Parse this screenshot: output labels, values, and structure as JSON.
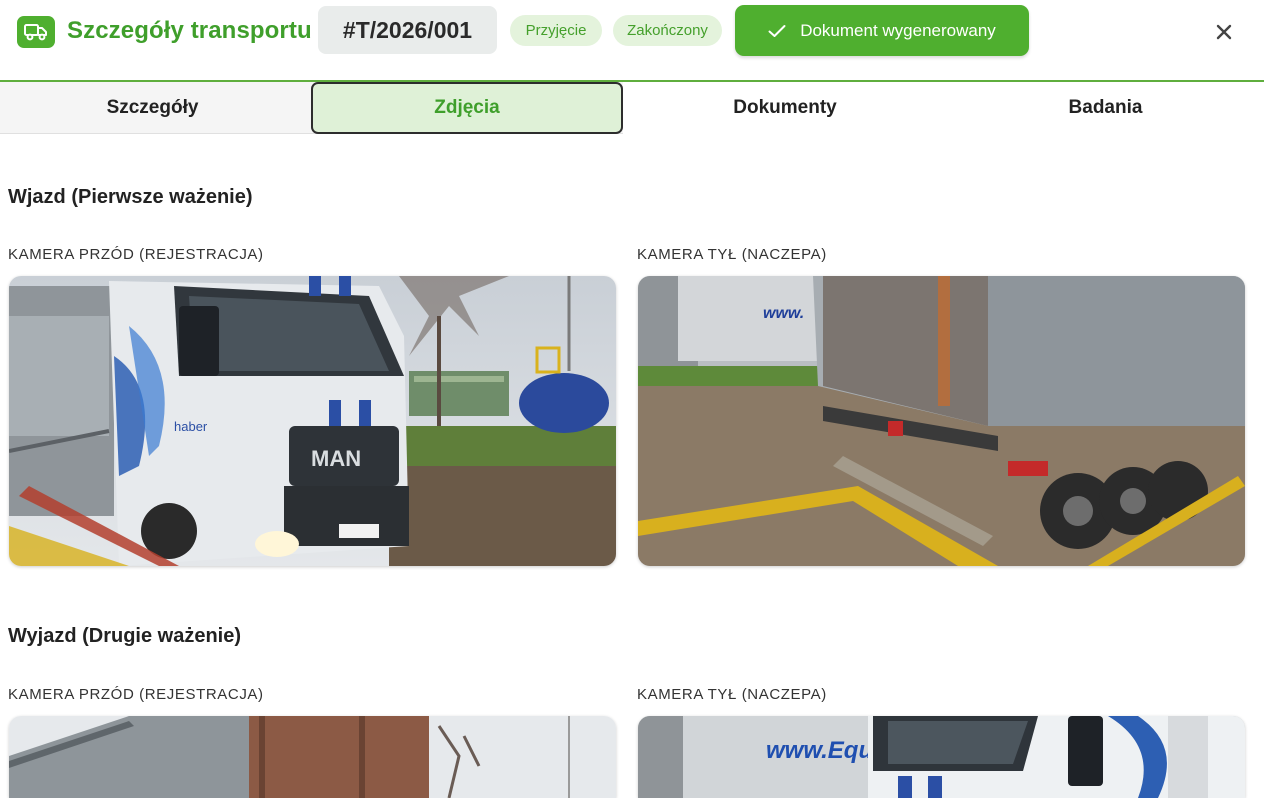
{
  "header": {
    "icon": "truck-icon",
    "title": "Szczegóły transportu",
    "transport_id": "#T/2026/001",
    "badges": [
      "Przyjęcie",
      "Zakończony"
    ],
    "doc_button_label": "Dokument wygenerowany",
    "close_icon": "close-icon"
  },
  "tabs": [
    {
      "label": "Szczegóły"
    },
    {
      "label": "Zdjęcia",
      "active": true
    },
    {
      "label": "Dokumenty"
    },
    {
      "label": "Badania"
    }
  ],
  "sections": [
    {
      "title": "Wjazd (Pierwsze ważenie)",
      "cameras": [
        {
          "label": "KAMERA PRZÓD (REJESTRACJA)",
          "brand_text": "MAN",
          "side_text": "haber"
        },
        {
          "label": "KAMERA TYŁ (NACZEPA)",
          "trailer_text": "www."
        }
      ]
    },
    {
      "title": "Wyjazd (Drugie ważenie)",
      "cameras": [
        {
          "label": "KAMERA PRZÓD (REJESTRACJA)"
        },
        {
          "label": "KAMERA TYŁ (NACZEPA)",
          "trailer_text": "www.Equ"
        }
      ]
    }
  ],
  "colors": {
    "brand_green": "#4faf2f",
    "title_green": "#3f9f2b",
    "badge_bg": "#e4f3dc",
    "active_tab_bg": "#dff1d7"
  }
}
